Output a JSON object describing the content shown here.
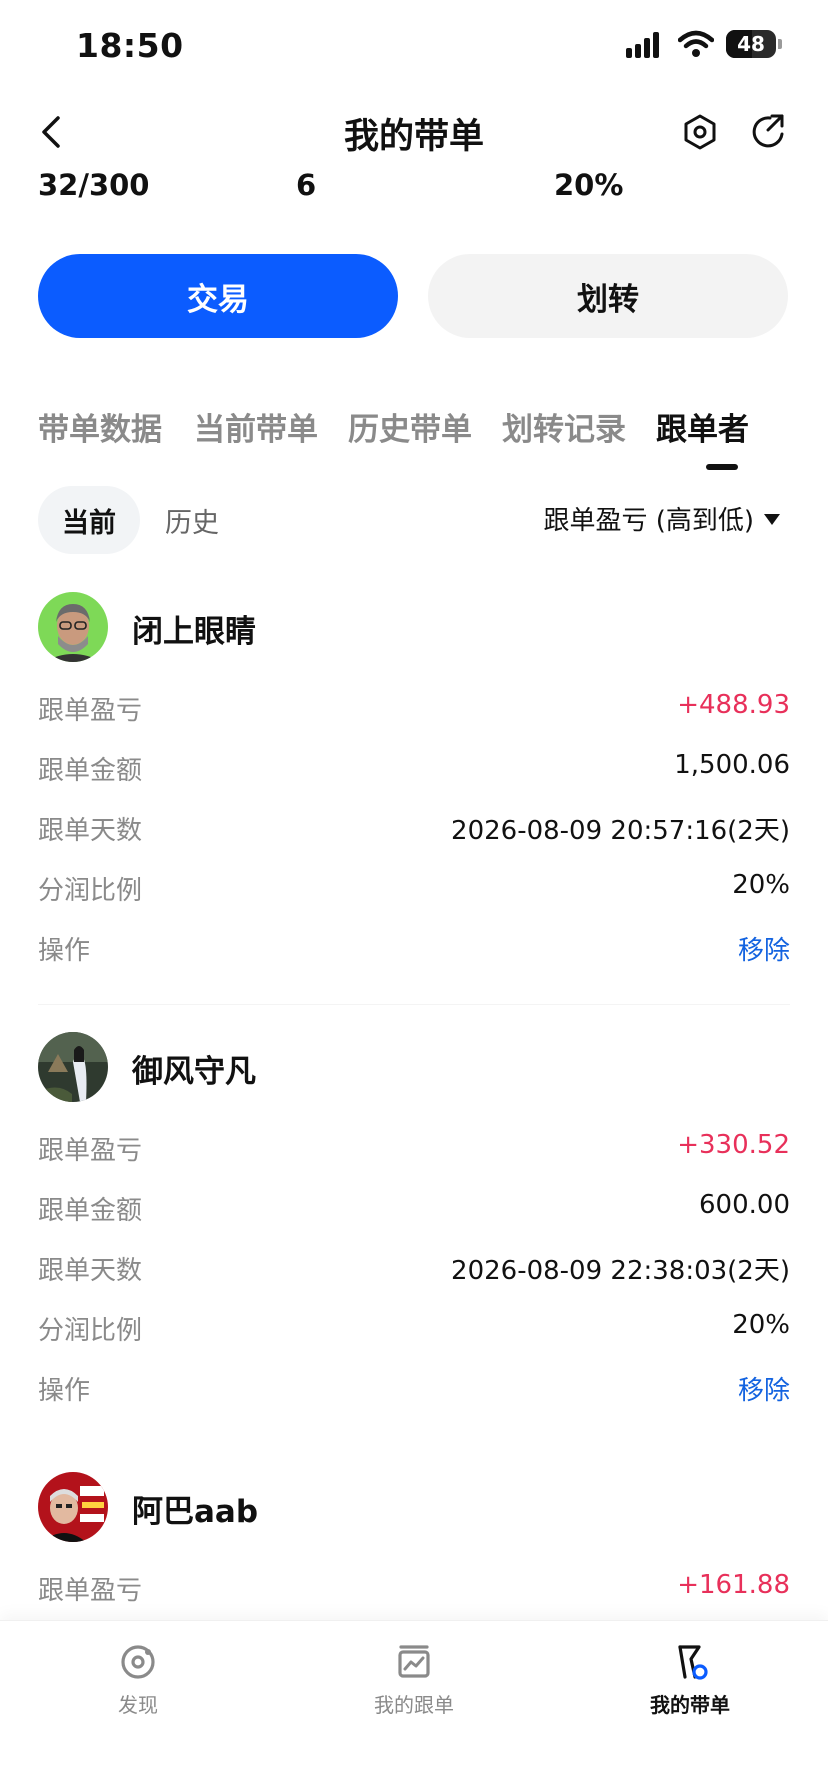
{
  "status_bar": {
    "time": "18:50",
    "battery": "48",
    "icons": [
      "signal-icon",
      "wifi-icon",
      "battery-icon"
    ]
  },
  "header": {
    "title": "我的带单",
    "back_icon": "chevron-left-icon",
    "settings_icon": "hexagon-settings-icon",
    "share_icon": "share-icon"
  },
  "stats": {
    "followers": "32/300",
    "count": "6",
    "share_ratio": "20%"
  },
  "actions": {
    "trade": "交易",
    "transfer": "划转"
  },
  "tabs": [
    {
      "label": "带单数据",
      "active": false
    },
    {
      "label": "当前带单",
      "active": false
    },
    {
      "label": "历史带单",
      "active": false
    },
    {
      "label": "划转记录",
      "active": false
    },
    {
      "label": "跟单者",
      "active": true
    }
  ],
  "filter": {
    "current": "当前",
    "history": "历史",
    "sort": "跟单盈亏 (高到低)"
  },
  "labels": {
    "pnl": "跟单盈亏",
    "amount": "跟单金额",
    "days": "跟单天数",
    "share": "分润比例",
    "operation": "操作"
  },
  "followers": [
    {
      "name": "闭上眼睛",
      "pnl": "+488.93",
      "amount": "1,500.06",
      "days": "2026-08-09 20:57:16(2天)",
      "share": "20%",
      "action": "移除"
    },
    {
      "name": "御风守凡",
      "pnl": "+330.52",
      "amount": "600.00",
      "days": "2026-08-09 22:38:03(2天)",
      "share": "20%",
      "action": "移除"
    },
    {
      "name": "阿巴aab",
      "pnl": "+161.88"
    }
  ],
  "bottom_nav": [
    {
      "label": "发现",
      "icon": "discover-icon",
      "active": false
    },
    {
      "label": "我的跟单",
      "icon": "chart-icon",
      "active": false
    },
    {
      "label": "我的带单",
      "icon": "flag-icon",
      "active": true
    }
  ],
  "colors": {
    "primary": "#0b5cff",
    "profit": "#e8305a",
    "link": "#1363e0",
    "muted": "#8a8a8a"
  }
}
